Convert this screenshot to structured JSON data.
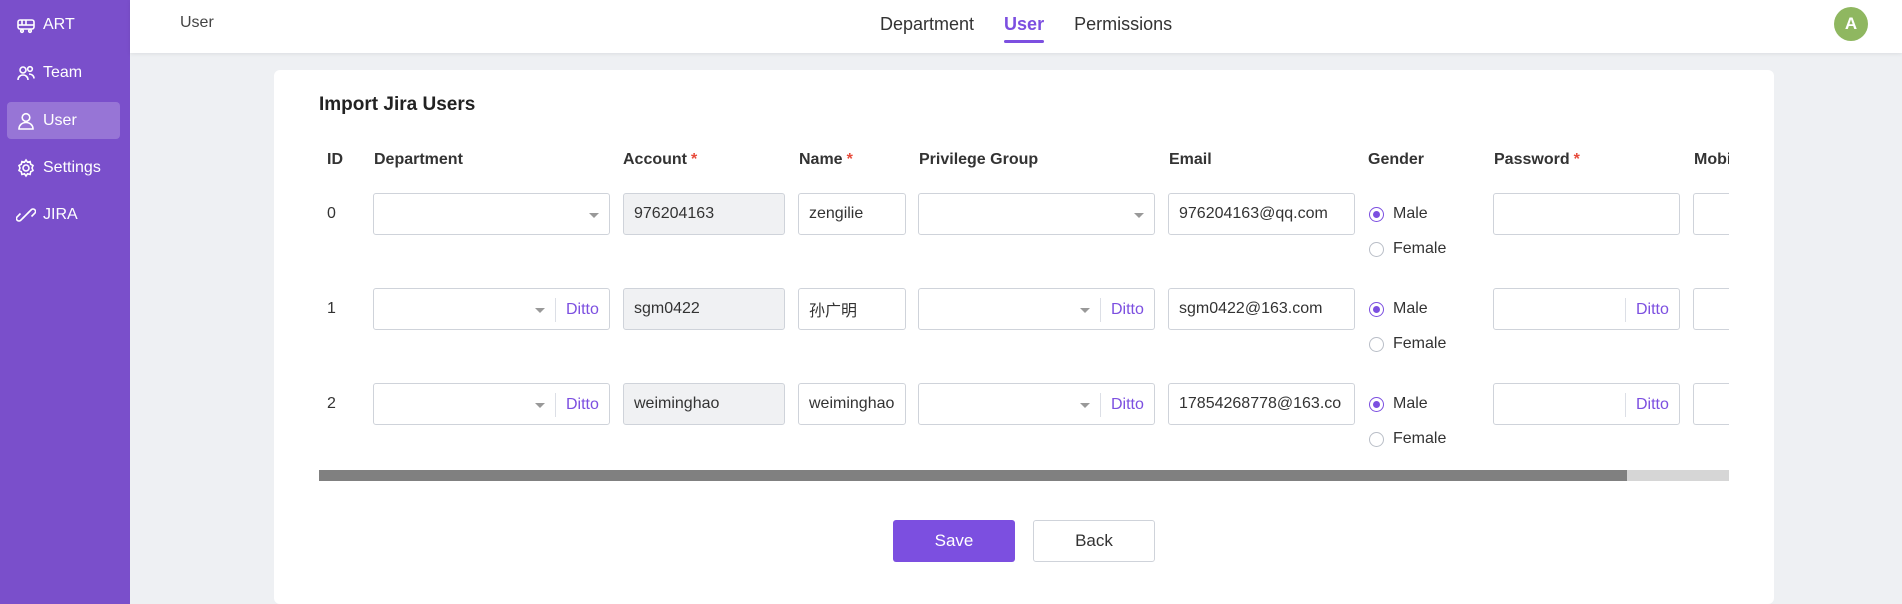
{
  "sidebar": {
    "items": [
      {
        "label": "ART",
        "icon": "train-icon"
      },
      {
        "label": "Team",
        "icon": "team-icon"
      },
      {
        "label": "User",
        "icon": "user-icon",
        "active": true
      },
      {
        "label": "Settings",
        "icon": "gear-icon"
      },
      {
        "label": "JIRA",
        "icon": "jira-icon"
      }
    ]
  },
  "header": {
    "breadcrumb": "User",
    "tabs": [
      {
        "label": "Department"
      },
      {
        "label": "User",
        "active": true
      },
      {
        "label": "Permissions"
      }
    ],
    "avatar_initial": "A"
  },
  "card": {
    "title": "Import Jira Users",
    "columns": {
      "id": "ID",
      "department": "Department",
      "account": "Account",
      "name": "Name",
      "privilege_group": "Privilege Group",
      "email": "Email",
      "gender": "Gender",
      "password": "Password",
      "mobile": "Mobi"
    },
    "required_mark": "*",
    "ditto_label": "Ditto",
    "gender_options": {
      "male": "Male",
      "female": "Female"
    },
    "rows": [
      {
        "id": "0",
        "account": "976204163",
        "name": "zengilie",
        "email": "976204163@qq.com",
        "gender": "Male"
      },
      {
        "id": "1",
        "account": "sgm0422",
        "name": "孙广明",
        "email": "sgm0422@163.com",
        "gender": "Male"
      },
      {
        "id": "2",
        "account": "weiminghao",
        "name": "weiminghao",
        "email": "17854268778@163.co",
        "gender": "Male"
      }
    ],
    "horizontal_scroll_fraction": 0.928
  },
  "actions": {
    "save": "Save",
    "back": "Back"
  },
  "colors": {
    "accent": "#7c4fe0",
    "sidebar": "#7a4fcb",
    "avatar": "#8fb760"
  }
}
